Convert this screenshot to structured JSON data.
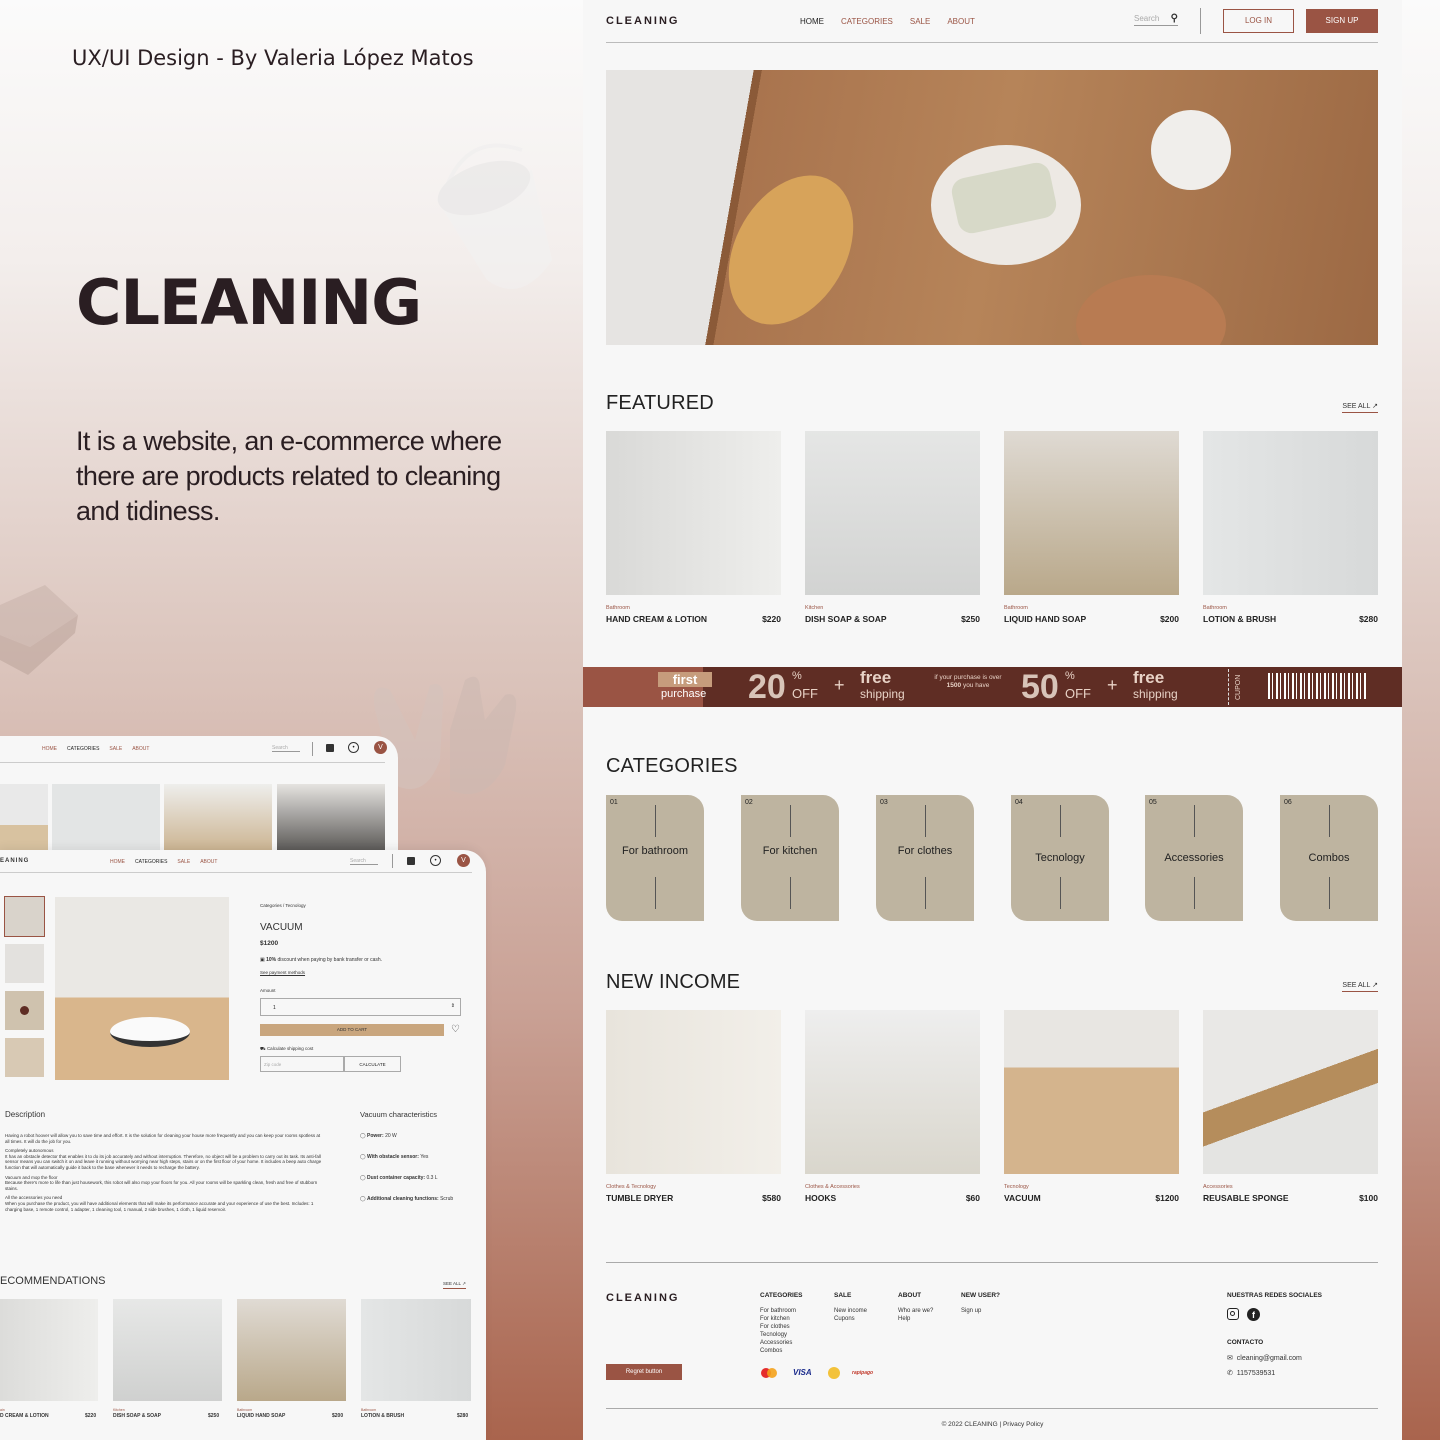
{
  "credit": "UX/UI Design - By Valeria López Matos",
  "brand_big": "CLEANING",
  "description": "It is a website, an e-commerce where there are products related to cleaning and tidiness.",
  "colors": {
    "accent": "#9a5444",
    "coupon_dark": "#5f2d24",
    "category_card": "#beb4a0"
  },
  "site": {
    "logo": "CLEANING",
    "nav": [
      "HOME",
      "CATEGORIES",
      "SALE",
      "ABOUT"
    ],
    "search_placeholder": "Search",
    "login": "LOG IN",
    "signup": "SIGN UP",
    "featured": {
      "title": "FEATURED",
      "see_all": "SEE ALL",
      "products": [
        {
          "category": "Bathroom",
          "name": "HAND CREAM & LOTION",
          "price": "$220"
        },
        {
          "category": "Kitchen",
          "name": "DISH SOAP & SOAP",
          "price": "$250"
        },
        {
          "category": "Bathroom",
          "name": "LIQUID HAND SOAP",
          "price": "$200"
        },
        {
          "category": "Bathroom",
          "name": "LOTION & BRUSH",
          "price": "$280"
        }
      ]
    },
    "coupon": {
      "first": "first",
      "purchase": "purchase",
      "pct1": "20",
      "pct2": "50",
      "percent": "%",
      "off": "OFF",
      "plus": "+",
      "free": "free",
      "shipping": "shipping",
      "condition_pre": "if your purchase is over",
      "condition_amount": "1500",
      "condition_post": "you have",
      "cupon": "CUPON"
    },
    "categories": {
      "title": "CATEGORIES",
      "items": [
        {
          "num": "01",
          "label": "For bathroom"
        },
        {
          "num": "02",
          "label": "For kitchen"
        },
        {
          "num": "03",
          "label": "For clothes"
        },
        {
          "num": "04",
          "label": "Tecnology"
        },
        {
          "num": "05",
          "label": "Accessories"
        },
        {
          "num": "06",
          "label": "Combos"
        }
      ]
    },
    "new_income": {
      "title": "NEW INCOME",
      "see_all": "SEE ALL",
      "products": [
        {
          "category": "Clothes & Tecnology",
          "name": "TUMBLE DRYER",
          "price": "$580"
        },
        {
          "category": "Clothes & Accessories",
          "name": "HOOKS",
          "price": "$60"
        },
        {
          "category": "Tecnology",
          "name": "VACUUM",
          "price": "$1200"
        },
        {
          "category": "Accessories",
          "name": "REUSABLE SPONGE",
          "price": "$100"
        }
      ]
    },
    "footer": {
      "logo": "CLEANING",
      "regret": "Regret button",
      "categories_title": "CATEGORIES",
      "categories": [
        "For bathroom",
        "For kitchen",
        "For clothes",
        "Tecnology",
        "Accessories",
        "Combos"
      ],
      "sale_title": "SALE",
      "sale": [
        "New income",
        "Cupons"
      ],
      "about_title": "ABOUT",
      "about": [
        "Who are we?",
        "Help"
      ],
      "newuser_title": "NEW USER?",
      "newuser": [
        "Sign up"
      ],
      "social_title": "NUESTRAS REDES SOCIALES",
      "contact_title": "CONTACTO",
      "email": "cleaning@gmail.com",
      "phone": "1157539531",
      "payments": [
        "VISA",
        "rapipago"
      ],
      "copyright": "© 2022 CLEANING | Privacy Policy"
    }
  },
  "mock": {
    "nav": [
      "HOME",
      "CATEGORIES",
      "SALE",
      "ABOUT"
    ],
    "search": "Search",
    "avatar": "V",
    "logo": "EANING",
    "breadcrumb": "Categories / Tecnology",
    "product": "VACUUM",
    "price": "$1200",
    "discount_bold": "10%",
    "discount_text": "discount when paying by bank transfer or cash.",
    "payment_link": "See payment methods",
    "amount_label": "Amount",
    "amount_value": "1",
    "add_to_cart": "ADD TO CART",
    "shipping_label": "Calculate shipping cost",
    "zip_placeholder": "Zip code",
    "calculate": "CALCULATE",
    "description_title": "Description",
    "description_p1": "Having a robot hoover will allow you to save time and effort. It is the solution for cleaning your house more frequently and you can keep your rooms spotless at all times. It will do the job for you.",
    "description_p2h": "Completely autonomous",
    "description_p2": "It has an obstacle detector that enables it to do its job accurately and without interruption. Therefore, no object will be a problem to carry out its task. Its anti-fall sensor means you can switch it on and leave it running without worrying near high steps, stairs or on the first floor of your home. It includes a beep auto charge function that will automatically guide it back to the base whenever it needs to recharge the battery.",
    "description_p3h": "Vacuum and mop the floor",
    "description_p3": "Because there's more to life than just housework, this robot will also mop your floors for you. All your rooms will be sparkling clean, fresh and free of stubborn stains.",
    "description_p4h": "All the accessories you need",
    "description_p4": "When you purchase the product, you will have additional elements that will make its performance accurate and your experience of use the best. Includes: 1 charging base, 1 remote control, 1 adapter, 1 cleaning tool, 1 manual, 2 side brushes, 1 cloth, 1 liquid reservoir.",
    "char_title": "Vacuum characteristics",
    "chars": [
      {
        "k": "Power:",
        "v": "20 W"
      },
      {
        "k": "With obstacle sensor:",
        "v": "Yes"
      },
      {
        "k": "Dust container capacity:",
        "v": "0.3 L"
      },
      {
        "k": "Additional cleaning functions:",
        "v": "Scrub"
      }
    ],
    "rec_title": "ECOMMENDATIONS",
    "see_all": "SEE ALL",
    "recs": [
      {
        "category": "ain",
        "name": "D CREAM & LOTION",
        "price": "$220"
      },
      {
        "category": "Kitchen",
        "name": "DISH SOAP & SOAP",
        "price": "$250"
      },
      {
        "category": "Bathroom",
        "name": "LIQUID HAND SOAP",
        "price": "$200"
      },
      {
        "category": "Bathroom",
        "name": "LOTION & BRUSH",
        "price": "$280"
      }
    ]
  }
}
